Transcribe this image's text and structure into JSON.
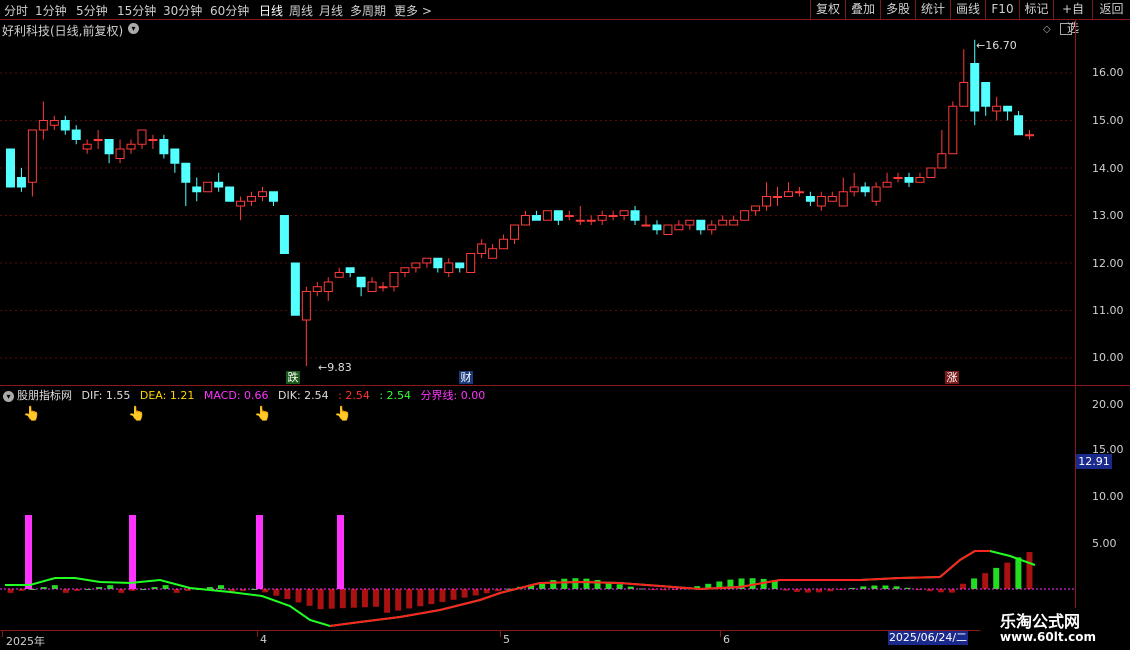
{
  "toolbar": {
    "periods": [
      "分时",
      "1分钟",
      "5分钟",
      "15分钟",
      "30分钟",
      "60分钟",
      "日线",
      "周线",
      "月线",
      "多周期",
      "更多 >"
    ],
    "active_period": "日线",
    "buttons": [
      "复权",
      "叠加",
      "多股",
      "统计",
      "画线",
      "F10",
      "标记",
      "+自选",
      "返回"
    ]
  },
  "stock": {
    "title": "好利科技(日线,前复权)"
  },
  "main_chart": {
    "price_axis": [
      "16.00",
      "15.00",
      "14.00",
      "13.00",
      "12.00",
      "11.00",
      "10.00"
    ],
    "high_annotation": "16.70",
    "low_annotation": "9.83",
    "markers": {
      "down": "跌",
      "fin": "财",
      "up": "涨"
    },
    "up_color": "#ff3b3b",
    "down_color": "#54ffff",
    "candles": [
      [
        14.4,
        13.6,
        14.4,
        13.6
      ],
      [
        13.8,
        13.6,
        14.0,
        13.5
      ],
      [
        13.7,
        14.8,
        14.8,
        13.4
      ],
      [
        14.8,
        15.0,
        15.4,
        14.6
      ],
      [
        14.9,
        15.0,
        15.1,
        14.8
      ],
      [
        15.0,
        14.8,
        15.1,
        14.7
      ],
      [
        14.8,
        14.6,
        14.9,
        14.5
      ],
      [
        14.4,
        14.5,
        14.6,
        14.3
      ],
      [
        14.6,
        14.6,
        14.8,
        14.4
      ],
      [
        14.6,
        14.3,
        14.6,
        14.1
      ],
      [
        14.2,
        14.4,
        14.6,
        14.1
      ],
      [
        14.4,
        14.5,
        14.6,
        14.3
      ],
      [
        14.5,
        14.8,
        14.8,
        14.4
      ],
      [
        14.6,
        14.6,
        14.7,
        14.4
      ],
      [
        14.6,
        14.3,
        14.7,
        14.2
      ],
      [
        14.4,
        14.1,
        14.4,
        13.9
      ],
      [
        14.1,
        13.7,
        14.1,
        13.2
      ],
      [
        13.6,
        13.5,
        13.8,
        13.3
      ],
      [
        13.5,
        13.7,
        13.7,
        13.5
      ],
      [
        13.7,
        13.6,
        13.9,
        13.5
      ],
      [
        13.6,
        13.3,
        13.6,
        13.3
      ],
      [
        13.2,
        13.3,
        13.4,
        12.9
      ],
      [
        13.3,
        13.4,
        13.5,
        13.2
      ],
      [
        13.4,
        13.5,
        13.6,
        13.3
      ],
      [
        13.5,
        13.3,
        13.5,
        13.2
      ],
      [
        13.0,
        12.2,
        13.0,
        12.2
      ],
      [
        12.0,
        10.9,
        12.0,
        10.9
      ],
      [
        10.8,
        11.4,
        11.5,
        9.83
      ],
      [
        11.4,
        11.5,
        11.6,
        11.3
      ],
      [
        11.4,
        11.6,
        11.7,
        11.2
      ],
      [
        11.7,
        11.8,
        11.9,
        11.7
      ],
      [
        11.9,
        11.8,
        11.9,
        11.7
      ],
      [
        11.7,
        11.5,
        11.7,
        11.3
      ],
      [
        11.4,
        11.6,
        11.7,
        11.4
      ],
      [
        11.5,
        11.5,
        11.6,
        11.4
      ],
      [
        11.5,
        11.8,
        11.8,
        11.4
      ],
      [
        11.8,
        11.9,
        11.9,
        11.7
      ],
      [
        11.9,
        12.0,
        12.0,
        11.8
      ],
      [
        12.0,
        12.1,
        12.1,
        11.9
      ],
      [
        12.1,
        11.9,
        12.1,
        11.8
      ],
      [
        11.8,
        12.0,
        12.1,
        11.7
      ],
      [
        12.0,
        11.9,
        12.0,
        11.8
      ],
      [
        11.8,
        12.2,
        12.2,
        11.8
      ],
      [
        12.2,
        12.4,
        12.5,
        12.1
      ],
      [
        12.1,
        12.3,
        12.4,
        12.1
      ],
      [
        12.3,
        12.5,
        12.6,
        12.3
      ],
      [
        12.5,
        12.8,
        12.8,
        12.4
      ],
      [
        12.8,
        13.0,
        13.1,
        12.8
      ],
      [
        13.0,
        12.9,
        13.1,
        12.9
      ],
      [
        12.9,
        13.1,
        13.1,
        12.9
      ],
      [
        13.1,
        12.9,
        13.1,
        12.8
      ],
      [
        13.0,
        13.0,
        13.1,
        12.9
      ],
      [
        12.9,
        12.9,
        13.2,
        12.8
      ],
      [
        12.9,
        12.9,
        13.0,
        12.8
      ],
      [
        12.9,
        13.0,
        13.1,
        12.8
      ],
      [
        13.0,
        13.0,
        13.1,
        12.9
      ],
      [
        13.0,
        13.1,
        13.1,
        12.9
      ],
      [
        13.1,
        12.9,
        13.2,
        12.8
      ],
      [
        12.8,
        12.8,
        13.0,
        12.8
      ],
      [
        12.8,
        12.7,
        12.9,
        12.6
      ],
      [
        12.6,
        12.8,
        12.8,
        12.6
      ],
      [
        12.7,
        12.8,
        12.9,
        12.7
      ],
      [
        12.8,
        12.9,
        12.9,
        12.7
      ],
      [
        12.9,
        12.7,
        12.9,
        12.6
      ],
      [
        12.7,
        12.8,
        12.9,
        12.6
      ],
      [
        12.8,
        12.9,
        13.0,
        12.8
      ],
      [
        12.8,
        12.9,
        13.0,
        12.8
      ],
      [
        12.9,
        13.1,
        13.1,
        12.9
      ],
      [
        13.1,
        13.2,
        13.2,
        13.0
      ],
      [
        13.2,
        13.4,
        13.7,
        13.1
      ],
      [
        13.4,
        13.4,
        13.6,
        13.2
      ],
      [
        13.4,
        13.5,
        13.7,
        13.4
      ],
      [
        13.5,
        13.5,
        13.6,
        13.4
      ],
      [
        13.4,
        13.3,
        13.5,
        13.2
      ],
      [
        13.2,
        13.4,
        13.5,
        13.1
      ],
      [
        13.3,
        13.4,
        13.5,
        13.3
      ],
      [
        13.2,
        13.5,
        13.8,
        13.2
      ],
      [
        13.5,
        13.6,
        13.9,
        13.4
      ],
      [
        13.6,
        13.5,
        13.7,
        13.4
      ],
      [
        13.3,
        13.6,
        13.7,
        13.2
      ],
      [
        13.6,
        13.7,
        13.9,
        13.6
      ],
      [
        13.8,
        13.8,
        13.9,
        13.7
      ],
      [
        13.8,
        13.7,
        13.9,
        13.6
      ],
      [
        13.7,
        13.8,
        13.9,
        13.7
      ],
      [
        13.8,
        14.0,
        14.0,
        13.8
      ],
      [
        14.0,
        14.3,
        14.8,
        14.3
      ],
      [
        14.3,
        15.3,
        15.4,
        14.3
      ],
      [
        15.3,
        15.8,
        16.5,
        15.3
      ],
      [
        16.2,
        15.2,
        16.7,
        14.9
      ],
      [
        15.8,
        15.3,
        15.8,
        15.1
      ],
      [
        15.2,
        15.3,
        15.5,
        15.0
      ],
      [
        15.3,
        15.2,
        15.3,
        15.0
      ],
      [
        15.1,
        14.7,
        15.2,
        14.7
      ],
      [
        14.7,
        14.7,
        14.8,
        14.6
      ]
    ]
  },
  "indicator": {
    "name": "股朋指标网",
    "dif_label": "DIF: 1.55",
    "dea_label": "DEA: 1.21",
    "macd_label": "MACD: 0.66",
    "dik_label": "DIK: 2.54",
    "val2_label": ": 2.54",
    "val3_label": ": 2.54",
    "split_label": "分界线: 0.00",
    "axis": [
      "20.00",
      "15.00",
      "10.00",
      "5.00"
    ],
    "current_price_box": "12.91",
    "colors": {
      "dif": "#ff2222",
      "dea": "#22ff22",
      "macd": "#ff33ff",
      "dik": "#ffffff",
      "split": "#ff33ff"
    },
    "signal_icon": "pointing-hand-icon",
    "signal_bars_count": 4
  },
  "time_axis": {
    "labels": [
      "2025年",
      "4",
      "5",
      "6"
    ],
    "cursor_date": "2025/06/24/二"
  },
  "watermark": {
    "title": "乐淘公式网",
    "url": "www.60lt.com"
  }
}
